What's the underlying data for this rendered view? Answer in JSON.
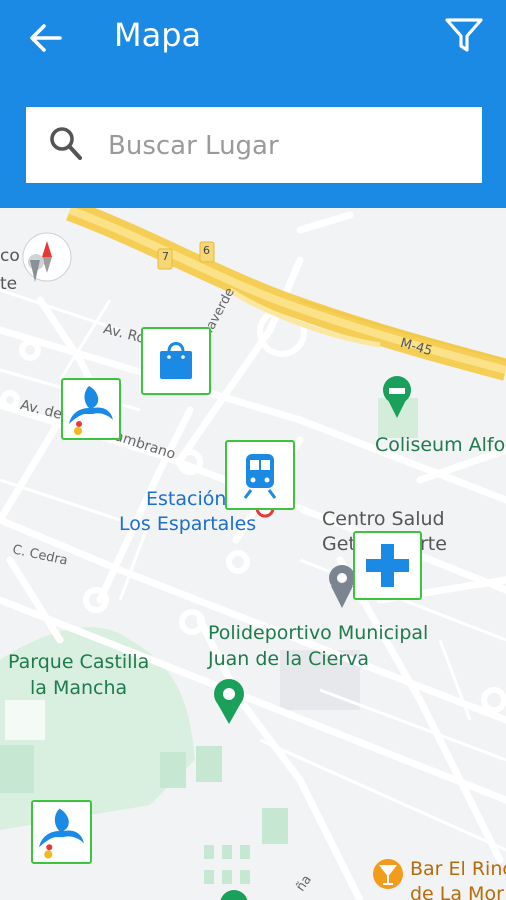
{
  "header": {
    "title": "Mapa",
    "back_icon": "arrow-left-icon",
    "filter_icon": "filter-icon"
  },
  "search": {
    "placeholder": "Buscar Lugar",
    "value": "",
    "icon": "search-icon"
  },
  "map": {
    "road_labels": {
      "highway_7": "7",
      "highway_6": "6",
      "m45": "M-45",
      "av_ro": "Av. Ro",
      "av_de": "Av. de",
      "cambrano": "Cambrano",
      "ctra_villaverde": "Ctra. de Villaverde",
      "c_cedra": "C. Cedra",
      "edge_co": "co",
      "edge_te": "te",
      "edge_na": "ña"
    },
    "places": {
      "coliseum": "Coliseum Alfo",
      "estacion_1": "Estación",
      "estacion_2": "Los Espartales",
      "centro_salud_1": "Centro Salud",
      "centro_salud_2": "Geta",
      "centro_salud_3": "rte",
      "polideportivo_1": "Polideportivo Municipal",
      "polideportivo_2": "Juan de la Cierva",
      "parque_1": "Parque Castilla",
      "parque_2": "la Mancha",
      "bar_1": "Bar El Rinc",
      "bar_2": "de La Mor"
    },
    "poi_markers": [
      "shopping-bag-icon",
      "caixa-bank-icon",
      "train-icon",
      "medical-cross-icon",
      "caixa-bank-icon"
    ],
    "colors": {
      "accent": "#1a8ae5",
      "marker_border": "#3cc43c",
      "park_text": "#1f7a4c",
      "station_text": "#1a6fd0"
    }
  }
}
